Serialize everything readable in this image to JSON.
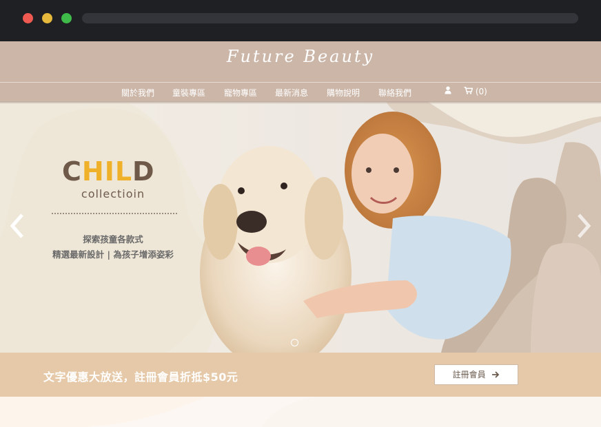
{
  "brand": {
    "logo": "Future Beauty"
  },
  "nav": {
    "items": [
      "關於我們",
      "童裝專區",
      "寵物專區",
      "最新消息",
      "購物說明",
      "聯絡我們"
    ],
    "user_icon": "user-icon",
    "cart_icon": "cart-icon",
    "cart_count": "(0)"
  },
  "hero": {
    "title_part1": "C",
    "title_part2": "HIL",
    "title_part3": "D",
    "subtitle": "collectioin",
    "line1": "探索孩童各款式",
    "line2": "精選最新設計 | 為孩子增添姿彩",
    "prev_icon": "chevron-left-icon",
    "next_icon": "chevron-right-icon"
  },
  "promo": {
    "text": "文字優惠大放送，註冊會員折抵$50元",
    "button_label": "註冊會員",
    "button_icon": "arrow-right-icon"
  },
  "colors": {
    "header": "#cbb6a8",
    "promo": "#e6c9a8",
    "accent": "#f0b12a",
    "brown": "#6f5a4a"
  }
}
